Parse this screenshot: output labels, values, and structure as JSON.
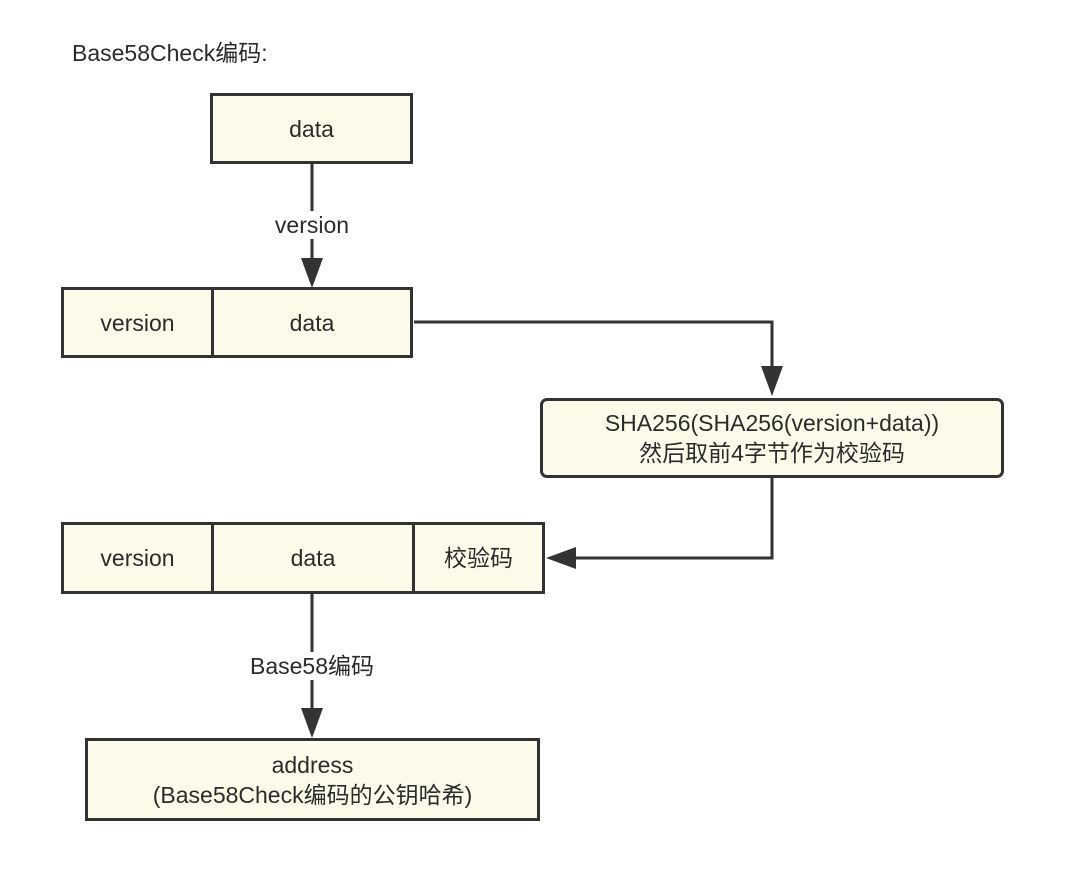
{
  "title": "Base58Check编码:",
  "nodes": {
    "data_top": "data",
    "row1_version": "version",
    "row1_data": "data",
    "hash_line1": "SHA256(SHA256(version+data))",
    "hash_line2": "然后取前4字节作为校验码",
    "row2_version": "version",
    "row2_data": "data",
    "row2_checksum": "校验码",
    "address_line1": "address",
    "address_line2": "(Base58Check编码的公钥哈希)"
  },
  "edges": {
    "add_version": "version",
    "base58_encode": "Base58编码"
  },
  "colors": {
    "box_fill": "#fcfbe9",
    "stroke": "#333333",
    "text": "#2b2b2b"
  }
}
